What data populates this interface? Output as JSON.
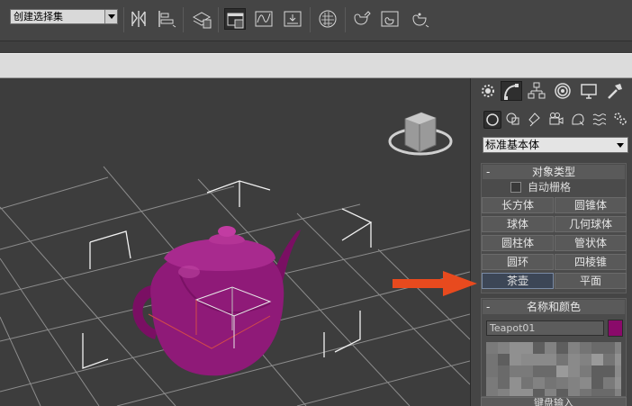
{
  "toolbar": {
    "selection_set": "创建选择集"
  },
  "command_panel": {
    "category_dropdown": "标准基本体",
    "object_type": {
      "title": "对象类型",
      "collapse": "-",
      "autogrid_label": "自动栅格",
      "buttons": [
        {
          "label": "长方体"
        },
        {
          "label": "圆锥体"
        },
        {
          "label": "球体"
        },
        {
          "label": "几何球体"
        },
        {
          "label": "圆柱体"
        },
        {
          "label": "管状体"
        },
        {
          "label": "圆环"
        },
        {
          "label": "四棱锥"
        },
        {
          "label": "茶壶"
        },
        {
          "label": "平面"
        }
      ],
      "selected": "茶壶"
    },
    "name_color": {
      "title": "名称和颜色",
      "collapse": "-",
      "name_value": "Teapot01",
      "object_color": "#8a0a6a"
    },
    "keyboard_entry": {
      "title": "键盘输入"
    }
  },
  "viewport": {
    "object_color": "#8f1a78",
    "grid_color": "#8c8c8c",
    "background": "#3d3d3d"
  },
  "annotation": {
    "arrow_color": "#e84a1e"
  }
}
